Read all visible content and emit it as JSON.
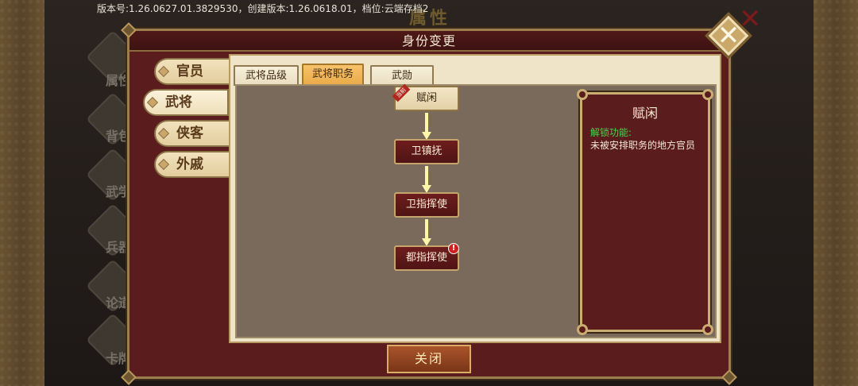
{
  "version_text": "版本号:1.26.0627.01.3829530，创建版本:1.26.0618.01，档位:云端存档2",
  "background": {
    "title": "属性",
    "nav_labels": [
      "属性",
      "背包",
      "武学",
      "兵器",
      "论道",
      "卡牌"
    ]
  },
  "dialog": {
    "title": "身份变更",
    "close_label": "关闭"
  },
  "categories": [
    {
      "label": "官员",
      "active": false
    },
    {
      "label": "武将",
      "active": true
    },
    {
      "label": "侠客",
      "active": false
    },
    {
      "label": "外戚",
      "active": false
    }
  ],
  "sub_tabs": [
    {
      "label": "武将品级",
      "active": false
    },
    {
      "label": "武将职务",
      "active": true
    },
    {
      "label": "武勋",
      "active": false
    }
  ],
  "ranks": [
    {
      "label": "赋闲",
      "current": true,
      "ribbon": "当前"
    },
    {
      "label": "卫镇抚",
      "current": false
    },
    {
      "label": "卫指挥使",
      "current": false
    },
    {
      "label": "都指挥使",
      "current": false,
      "badge": "!"
    }
  ],
  "info": {
    "title": "赋闲",
    "unlock_label": "解锁功能:",
    "description": "未被安排职务的地方官员"
  },
  "colors": {
    "dialog_bg": "#5a1c1c",
    "active_tab": "#f7c36a",
    "unlock_text": "#3fd84a",
    "arrow": "#fff6a8"
  }
}
